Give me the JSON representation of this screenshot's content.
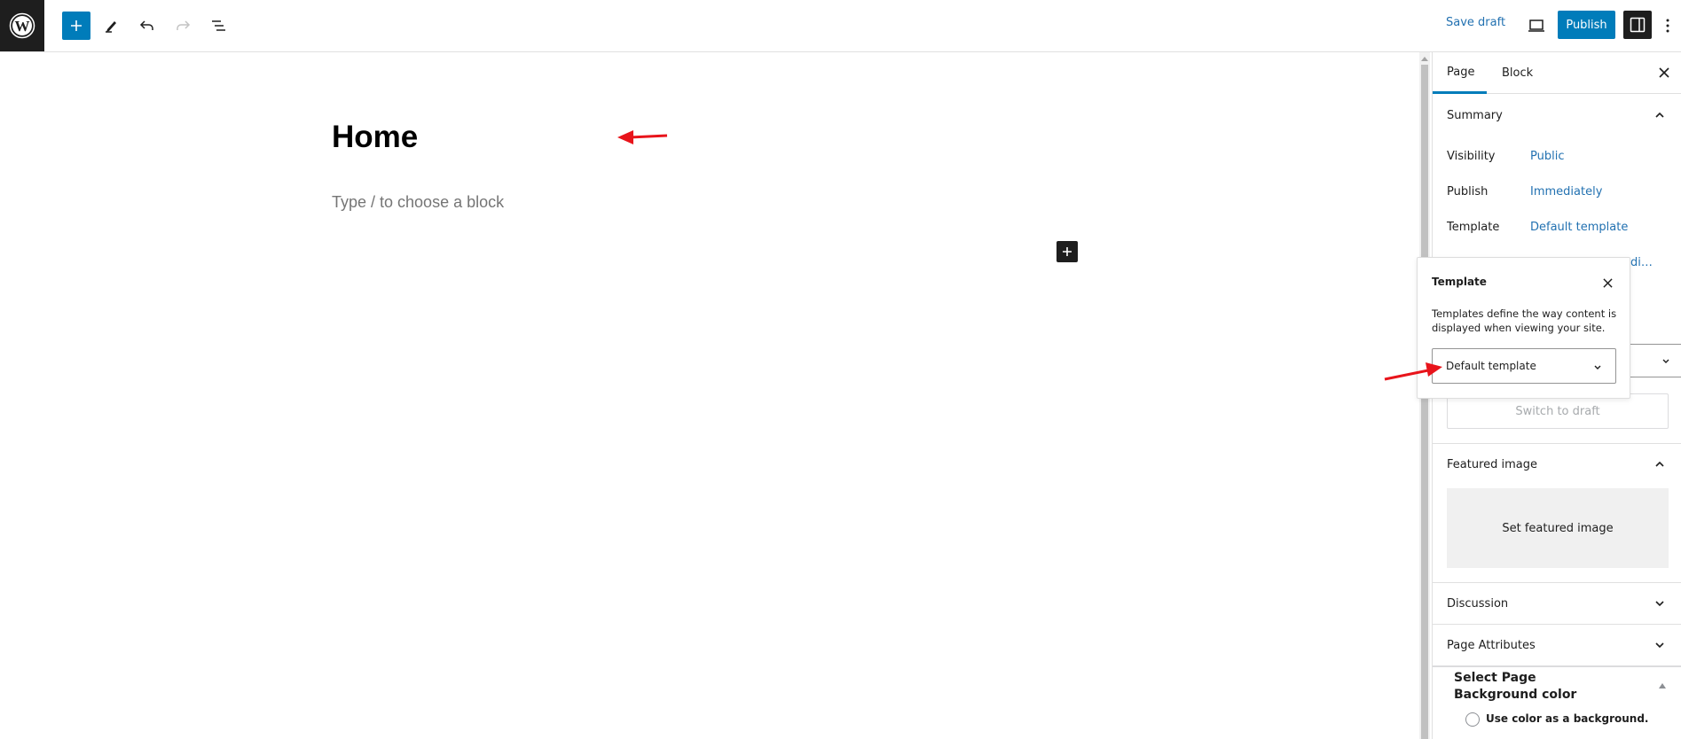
{
  "toolbar": {
    "logo_icon": "wordpress-logo",
    "inserter_icon": "plus-icon",
    "tools_icon": "pencil-icon",
    "undo_icon": "undo-icon",
    "redo_icon": "redo-icon",
    "list_view_icon": "list-view-icon",
    "save_draft_label": "Save draft",
    "preview_icon": "laptop-icon",
    "publish_label": "Publish",
    "settings_icon": "sidebar-toggle-icon",
    "more_icon": "vertical-ellipsis-icon",
    "accent_color": "#007cba"
  },
  "editor": {
    "title": "Home",
    "block_placeholder": "Type / to choose a block",
    "block_add_icon": "plus-icon"
  },
  "sidebar": {
    "tabs": [
      {
        "label": "Page",
        "active": true
      },
      {
        "label": "Block",
        "active": false
      }
    ],
    "close_icon": "close-icon",
    "summary": {
      "title": "Summary",
      "expanded": true,
      "rows": [
        {
          "label": "Visibility",
          "value": "Public"
        },
        {
          "label": "Publish",
          "value": "Immediately"
        },
        {
          "label": "Template",
          "value": "Default template"
        }
      ],
      "truncated_link": "di…",
      "switch_to_draft": "Switch to draft"
    },
    "featured_image": {
      "title": "Featured image",
      "expanded": true,
      "set_label": "Set featured image"
    },
    "discussion": {
      "title": "Discussion",
      "expanded": false
    },
    "page_attributes": {
      "title": "Page Attributes",
      "expanded": false
    },
    "page_background": {
      "title": "Select Page Background color",
      "option_label": "Use color as a background.",
      "checked": false
    }
  },
  "template_popover": {
    "title": "Template",
    "description": "Templates define the way content is displayed when viewing your site.",
    "selected": "Default template",
    "close_icon": "close-icon"
  },
  "annotations": {
    "arrow_color": "#e8141b"
  }
}
